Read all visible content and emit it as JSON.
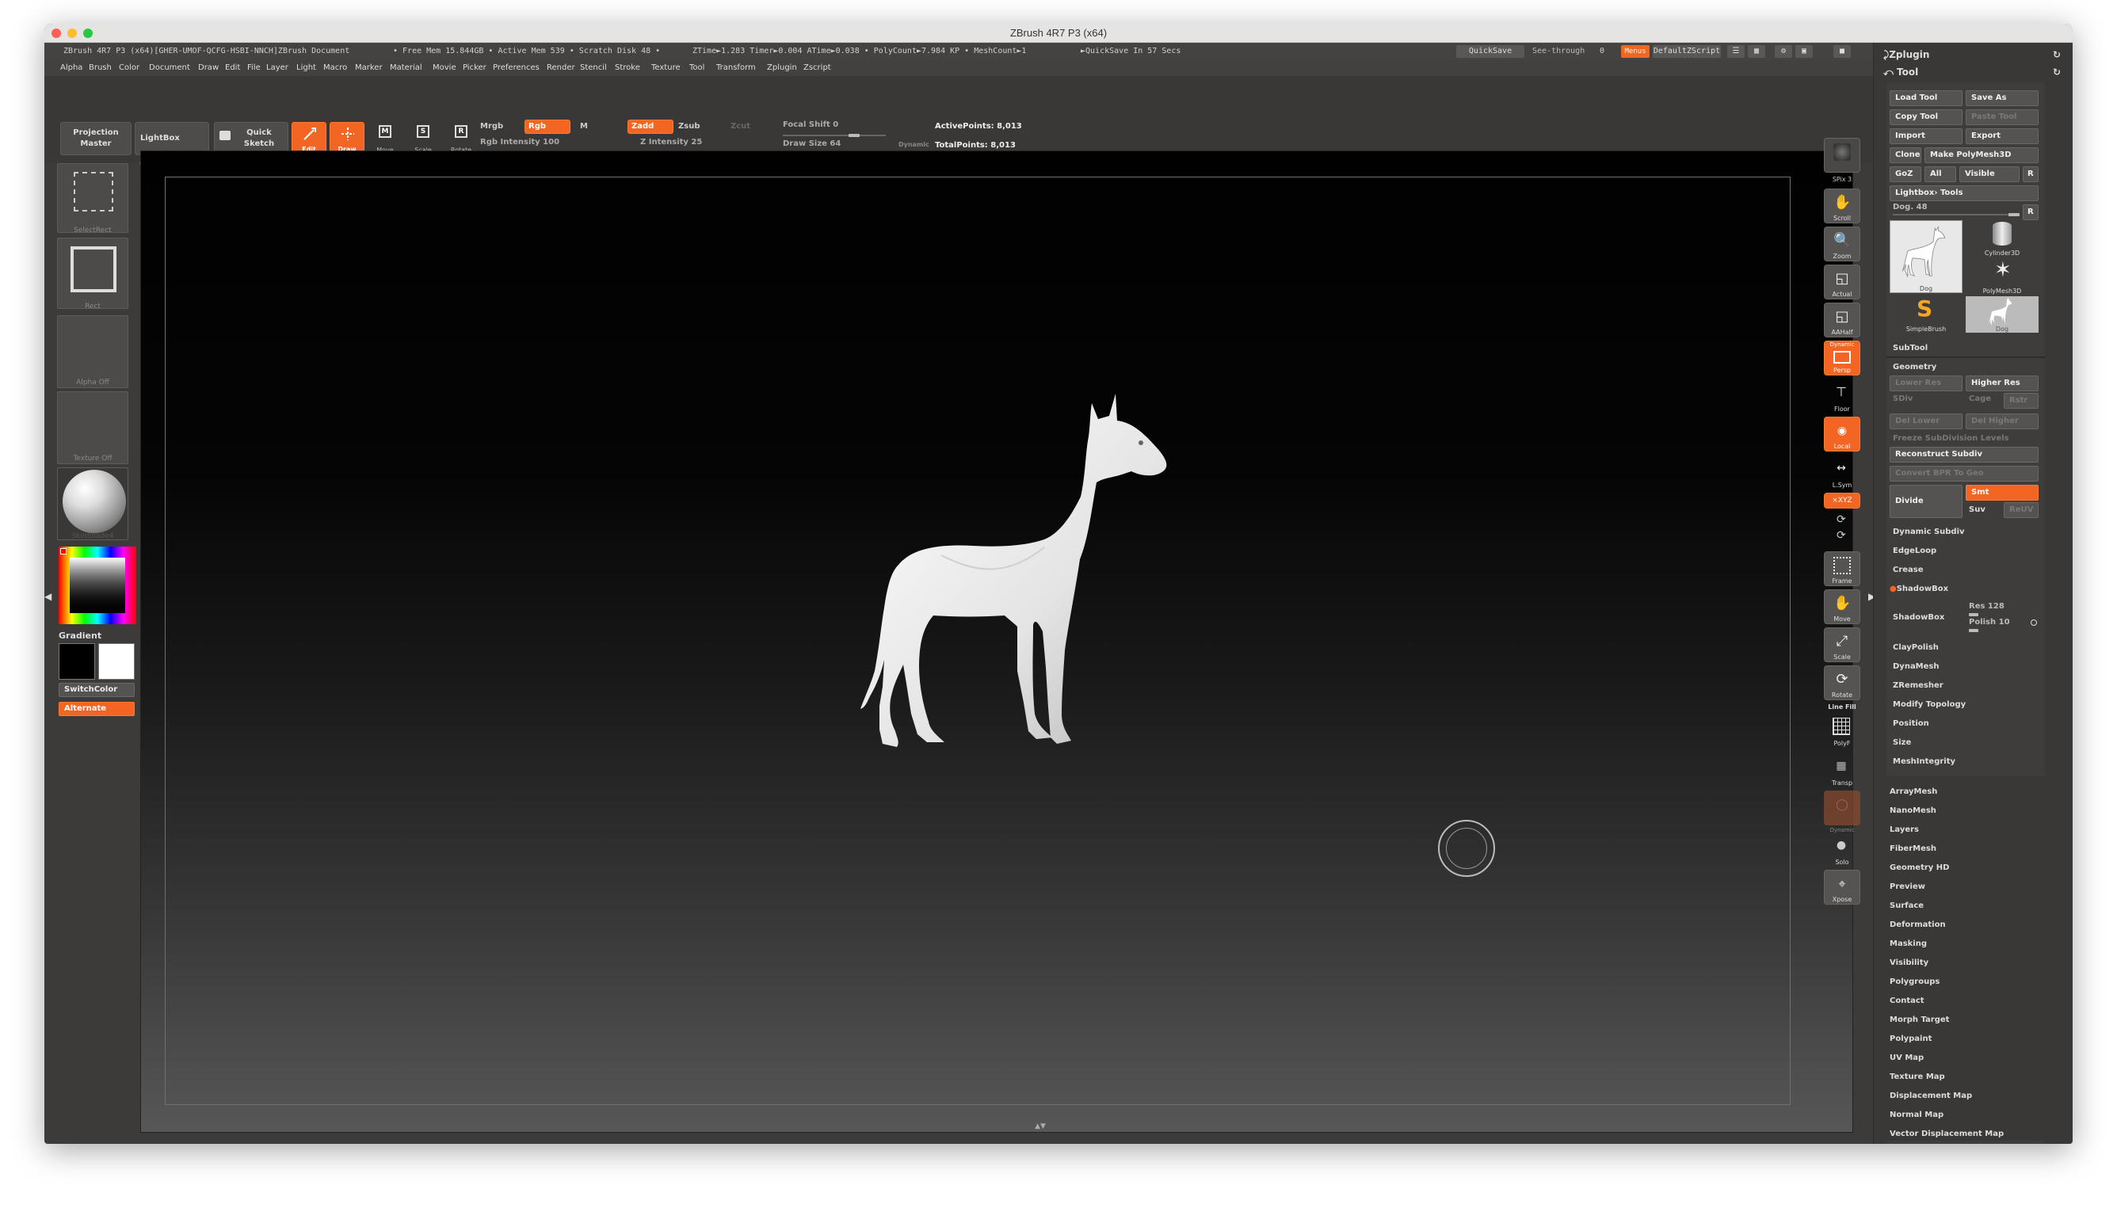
{
  "window": {
    "title": "ZBrush 4R7 P3 (x64)"
  },
  "infobar": {
    "doc": "ZBrush 4R7 P3 (x64)[GHER-UMOF-QCFG-HSBI-NNCH]ZBrush Document",
    "free_mem": "• Free Mem 15.844GB • Active Mem 539 • Scratch Disk 48 •",
    "ztime": "ZTime►1.283 Timer►0.004 ATime►0.038 • PolyCount►7.984 KP • MeshCount►1",
    "quicksave_in": "►QuickSave In 57 Secs",
    "quicksave_btn": "QuickSave",
    "see_through": "See-through",
    "see_through_val": "0",
    "menus_btn": "Menus",
    "default_zscript": "DefaultZScript"
  },
  "menubar": [
    "Alpha",
    "Brush",
    "Color",
    "Document",
    "Draw",
    "Edit",
    "File",
    "Layer",
    "Light",
    "Macro",
    "Marker",
    "Material",
    "Movie",
    "Picker",
    "Preferences",
    "Render",
    "Stencil",
    "Stroke",
    "Texture",
    "Tool",
    "Transform",
    "Zplugin",
    "Zscript"
  ],
  "topshelf": {
    "projection_master": "Projection Master",
    "lightbox": "LightBox",
    "quick_sketch": "Quick Sketch",
    "edit": "Edit",
    "draw": "Draw",
    "move": "Move",
    "scale": "Scale",
    "rotate": "Rotate",
    "mrgb": "Mrgb",
    "rgb": "Rgb",
    "m": "M",
    "rgb_intensity": "Rgb Intensity 100",
    "zadd": "Zadd",
    "zsub": "Zsub",
    "zcut": "Zcut",
    "z_intensity": "Z Intensity 25",
    "focal_shift": "Focal Shift 0",
    "draw_size": "Draw Size 64",
    "dynamic": "Dynamic",
    "active_points": "ActivePoints: 8,013",
    "total_points": "TotalPoints: 8,013"
  },
  "leftshelf": {
    "selectrect": "SelectRect",
    "rect": "Rect",
    "alpha_off": "Alpha Off",
    "texture_off": "Texture Off",
    "matcap": "SkinShade4",
    "gradient": "Gradient",
    "switchcolor": "SwitchColor",
    "alternate": "Alternate"
  },
  "rightshelf": {
    "spix": "SPix 3",
    "scroll": "Scroll",
    "zoom": "Zoom",
    "actual": "Actual",
    "aahalf": "AAHalf",
    "dynamic": "Dynamic",
    "persp": "Persp",
    "floor": "Floor",
    "local": "Local",
    "lsym": "L.Sym",
    "xyz": "×XYZ",
    "frame": "Frame",
    "move": "Move",
    "scale": "Scale",
    "rotate": "Rotate",
    "line_fill": "Line Fill",
    "polyf": "PolyF",
    "transp": "Transp",
    "ghost": "Ghost",
    "solo": "Solo",
    "xpose": "Xpose"
  },
  "tray": {
    "zplugin": "Zplugin",
    "tool": "Tool",
    "load_tool": "Load Tool",
    "save_as": "Save As",
    "copy_tool": "Copy Tool",
    "paste_tool": "Paste Tool",
    "import": "Import",
    "export": "Export",
    "clone": "Clone",
    "make_polymesh": "Make PolyMesh3D",
    "goz": "GoZ",
    "all": "All",
    "visible": "Visible",
    "r": "R",
    "lightbox_tools": "Lightbox› Tools",
    "dog_slider": "Dog. 48",
    "thumbs": [
      "Dog",
      "Cylinder3D",
      "PolyMesh3D",
      "SimpleBrush",
      "Dog"
    ],
    "subtool": "SubTool",
    "geometry": "Geometry",
    "lower_res": "Lower Res",
    "higher_res": "Higher Res",
    "sdiv": "SDiv",
    "cage": "Cage",
    "rstr": "Rstr",
    "del_lower": "Del Lower",
    "del_higher": "Del Higher",
    "freeze": "Freeze SubDivision Levels",
    "reconstruct": "Reconstruct Subdiv",
    "convert_bpr": "Convert BPR To Geo",
    "divide": "Divide",
    "smt": "Smt",
    "suv": "Suv",
    "reuv": "ReUV",
    "sections": [
      "Dynamic Subdiv",
      "EdgeLoop",
      "Crease",
      "ShadowBox"
    ],
    "shadowbox": "ShadowBox",
    "res": "Res 128",
    "polish": "Polish 10",
    "sections2": [
      "ClayPolish",
      "DynaMesh",
      "ZRemesher",
      "Modify Topology",
      "Position",
      "Size",
      "MeshIntegrity"
    ],
    "list": [
      "ArrayMesh",
      "NanoMesh",
      "Layers",
      "FiberMesh",
      "Geometry HD",
      "Preview",
      "Surface",
      "Deformation",
      "Masking",
      "Visibility",
      "Polygroups",
      "Contact",
      "Morph Target",
      "Polypaint",
      "UV Map",
      "Texture Map",
      "Displacement Map",
      "Normal Map",
      "Vector Displacement Map"
    ]
  },
  "colors": {
    "accent": "#f26522",
    "background": "#3d3b3a"
  }
}
